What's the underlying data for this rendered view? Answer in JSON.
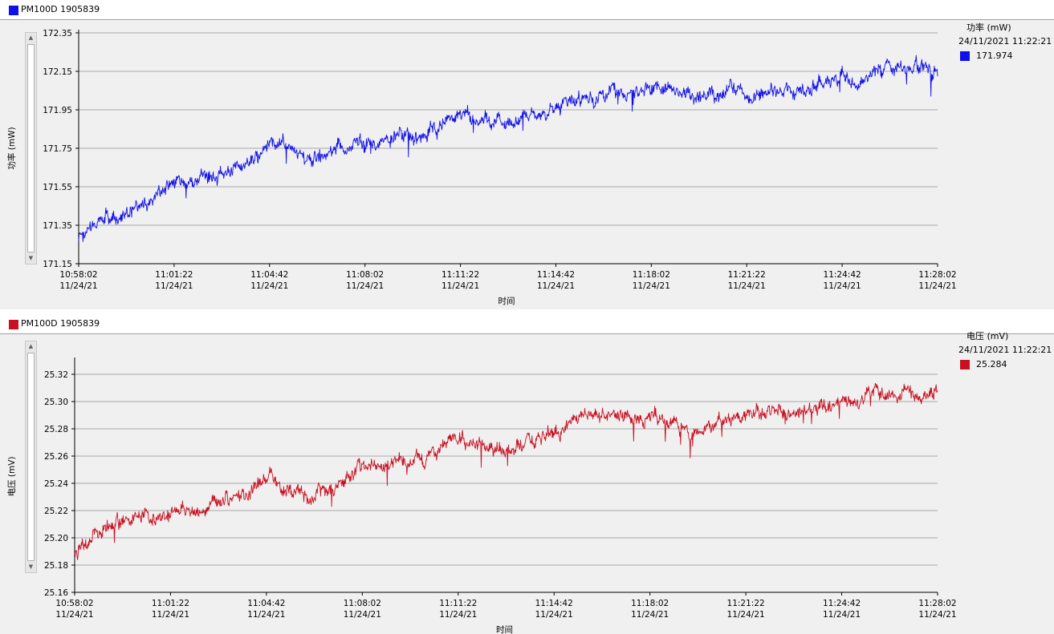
{
  "panels": [
    {
      "device": "PM100D 1905839",
      "color": "#1010e8",
      "legend": {
        "title": "功率 (mW)",
        "time": "24/11/2021 11:22:21",
        "value": "171.974"
      },
      "chart_data": {
        "type": "line",
        "xlabel": "时间",
        "ylabel": "功率 (mW)",
        "grid": true,
        "ylim": [
          171.15,
          172.35
        ],
        "yticks": [
          "172.35",
          "172.15",
          "171.95",
          "171.75",
          "171.55",
          "171.35",
          "171.15"
        ],
        "xticks": [
          {
            "time": "10:58:02",
            "date": "11/24/21"
          },
          {
            "time": "11:01:22",
            "date": "11/24/21"
          },
          {
            "time": "11:04:42",
            "date": "11/24/21"
          },
          {
            "time": "11:08:02",
            "date": "11/24/21"
          },
          {
            "time": "11:11:22",
            "date": "11/24/21"
          },
          {
            "time": "11:14:42",
            "date": "11/24/21"
          },
          {
            "time": "11:18:02",
            "date": "11/24/21"
          },
          {
            "time": "11:21:22",
            "date": "11/24/21"
          },
          {
            "time": "11:24:42",
            "date": "11/24/21"
          },
          {
            "time": "11:28:02",
            "date": "11/24/21"
          }
        ],
        "series": [
          {
            "x": [
              "10:58:02",
              "10:59:42",
              "11:01:22",
              "11:03:02",
              "11:04:42",
              "11:06:22",
              "11:08:02",
              "11:09:42",
              "11:11:22",
              "11:13:02",
              "11:14:42",
              "11:16:22",
              "11:18:02",
              "11:19:42",
              "11:21:22",
              "11:23:02",
              "11:24:42",
              "11:26:22",
              "11:28:02"
            ],
            "y": [
              171.3,
              171.42,
              171.55,
              171.62,
              171.8,
              171.72,
              171.8,
              171.78,
              171.9,
              171.88,
              171.95,
              172.05,
              172.05,
              172.0,
              172.02,
              172.05,
              172.12,
              172.15,
              172.15
            ]
          }
        ]
      }
    },
    {
      "device": "PM100D 1905839",
      "color": "#c81020",
      "legend": {
        "title": "电压 (mV)",
        "time": "24/11/2021 11:22:21",
        "value": "25.284"
      },
      "chart_data": {
        "type": "line",
        "xlabel": "时间",
        "ylabel": "电压 (mV)",
        "grid": true,
        "ylim": [
          25.16,
          25.33
        ],
        "yticks": [
          "25.32",
          "25.30",
          "25.28",
          "25.26",
          "25.24",
          "25.22",
          "25.20",
          "25.18",
          "25.16"
        ],
        "xticks": [
          {
            "time": "10:58:02",
            "date": "11/24/21"
          },
          {
            "time": "11:01:22",
            "date": "11/24/21"
          },
          {
            "time": "11:04:42",
            "date": "11/24/21"
          },
          {
            "time": "11:08:02",
            "date": "11/24/21"
          },
          {
            "time": "11:11:22",
            "date": "11/24/21"
          },
          {
            "time": "11:14:42",
            "date": "11/24/21"
          },
          {
            "time": "11:18:02",
            "date": "11/24/21"
          },
          {
            "time": "11:21:22",
            "date": "11/24/21"
          },
          {
            "time": "11:24:42",
            "date": "11/24/21"
          },
          {
            "time": "11:28:02",
            "date": "11/24/21"
          }
        ],
        "series": [
          {
            "x": [
              "10:58:02",
              "10:59:42",
              "11:01:22",
              "11:03:02",
              "11:04:42",
              "11:06:22",
              "11:08:02",
              "11:09:42",
              "11:11:22",
              "11:13:02",
              "11:14:42",
              "11:16:22",
              "11:18:02",
              "11:19:42",
              "11:21:22",
              "11:23:02",
              "11:24:42",
              "11:26:22",
              "11:28:02"
            ],
            "y": [
              25.19,
              25.205,
              25.21,
              25.225,
              25.245,
              25.235,
              25.25,
              25.255,
              25.27,
              25.265,
              25.28,
              25.29,
              25.29,
              25.285,
              25.29,
              25.295,
              25.3,
              25.305,
              25.305
            ]
          }
        ]
      }
    }
  ]
}
